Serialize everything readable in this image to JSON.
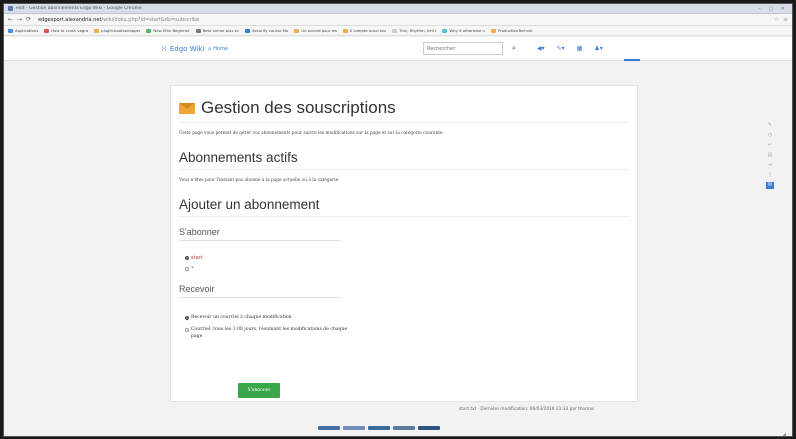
{
  "browser": {
    "window_title": "edit - Gestion abonnements Edgo Wiki - Google Chrome",
    "url_host": "edgexport.alexandria.net",
    "url_path": "/wiki/doku.php?id=start&do=subscribe",
    "bookmarks": [
      {
        "label": "Applications",
        "color": "#4a90d9"
      },
      {
        "label": "How to crash vagra",
        "color": "#d9534f"
      },
      {
        "label": "plugin:bootswrapper",
        "color": "#f0ad4e"
      },
      {
        "label": "New Elite Beginner",
        "color": "#5cb85c"
      },
      {
        "label": "Beta anime plus ec",
        "color": "#777777"
      },
      {
        "label": "Security course Mo",
        "color": "#3b7bd6"
      },
      {
        "label": "Un accord pour les",
        "color": "#f0ad4e"
      },
      {
        "label": "Il compte aussi tou",
        "color": "#f0ad4e"
      },
      {
        "label": "Thin, Rhythm, hell f",
        "color": "#cccccc"
      },
      {
        "label": "Why it otherwise n",
        "color": "#5bc0de"
      },
      {
        "label": "ProductionTechnik",
        "color": "#f0ad4e"
      }
    ]
  },
  "wiki": {
    "name": "Edgo Wiki",
    "home": "Home",
    "search_placeholder": "Rechercher"
  },
  "page": {
    "title": "Gestion des souscriptions",
    "intro": "Cette page vous permet de gérer vos abonnements pour suivre les modifications sur la page et sur la catégorie courante.",
    "active_heading": "Abonnements actifs",
    "active_text": "Vous n'êtes pour l'instant pas abonné à la page actuelle ou à la catégorie",
    "add_heading": "Ajouter un abonnement",
    "subscribe_label": "S'abonner",
    "subscribe_options": [
      "start",
      "*"
    ],
    "receive_label": "Recevoir",
    "receive_options": [
      "Recevoir un courriel à chaque modification",
      "Courriel, tous les 1.00 jours, résumant les modifications de chaque page"
    ],
    "submit": "S'abonner"
  },
  "footer": {
    "text": "start.txt · Dernière modification: 06/03/2016 21:33 par thomas"
  }
}
